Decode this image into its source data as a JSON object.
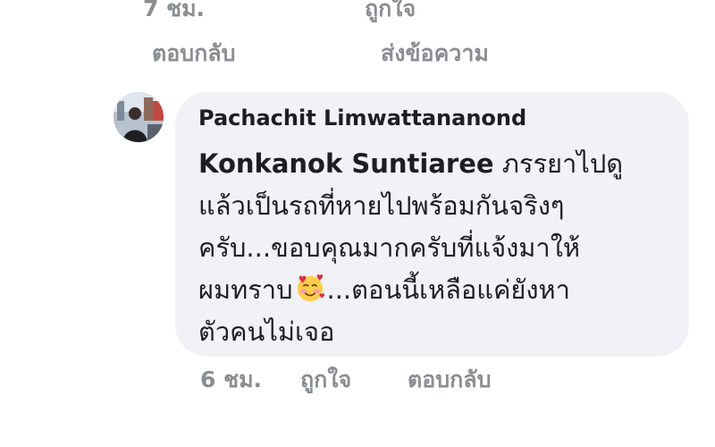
{
  "previous_comment": {
    "time": "7 ชม.",
    "like_label": "ถูกใจ",
    "reply_label": "ตอบกลับ",
    "message_label": "ส่งข้อความ"
  },
  "comment": {
    "author": "Pachachit Limwattananond",
    "mention": "Konkanok Suntiaree",
    "lines": [
      " ภรรยาไปดู",
      "แล้วเป็นรถที่หายไปพร้อมกันจริงๆ",
      "ครับ...ขอบคุณมากครับที่แจ้งมาให้",
      "ผมทราบ",
      "...ตอนนี้เหลือแค่ยังหา",
      "ตัวคนไม่เจอ"
    ],
    "emoji": "smiling-face-with-hearts-icon",
    "time": "6 ชม.",
    "like_label": "ถูกใจ",
    "reply_label": "ตอบกลับ"
  },
  "colors": {
    "bubble": "#f0f2f5",
    "text": "#1c1e21",
    "meta": "#8a8d91"
  }
}
